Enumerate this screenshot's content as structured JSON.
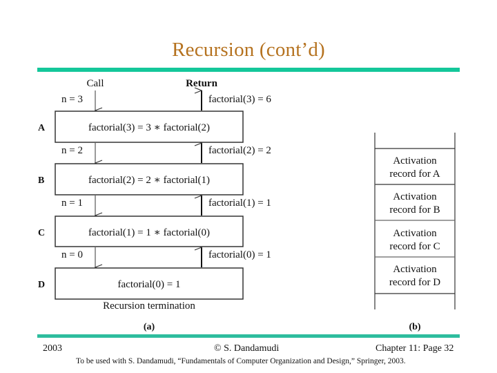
{
  "slide": {
    "title": "Recursion (cont’d)",
    "accent_color": "#14c79a",
    "title_color": "#b5721f"
  },
  "diagram_a": {
    "caption": "(a)",
    "call_header": "Call",
    "return_header": "Return",
    "calls": [
      "n = 3",
      "n = 2",
      "n = 1",
      "n = 0"
    ],
    "returns": [
      "factorial(3) = 6",
      "factorial(2) = 2",
      "factorial(1) = 1",
      "factorial(0) = 1"
    ],
    "frames": [
      {
        "label": "A",
        "text": "factorial(3) = 3 ∗ factorial(2)"
      },
      {
        "label": "B",
        "text": "factorial(2) = 2 ∗ factorial(1)"
      },
      {
        "label": "C",
        "text": "factorial(1) = 1 ∗ factorial(0)"
      },
      {
        "label": "D",
        "text": "factorial(0) = 1"
      }
    ],
    "termination_label": "Recursion termination"
  },
  "diagram_b": {
    "caption": "(b)",
    "records": [
      {
        "line1": "Activation",
        "line2": "record for A"
      },
      {
        "line1": "Activation",
        "line2": "record for B"
      },
      {
        "line1": "Activation",
        "line2": "record for C"
      },
      {
        "line1": "Activation",
        "line2": "record for D"
      }
    ]
  },
  "footer": {
    "year": "2003",
    "copyright": "© S. Dandamudi",
    "page": "Chapter 11: Page 32",
    "note": "To be used with S. Dandamudi, “Fundamentals of Computer Organization and Design,” Springer, 2003."
  }
}
